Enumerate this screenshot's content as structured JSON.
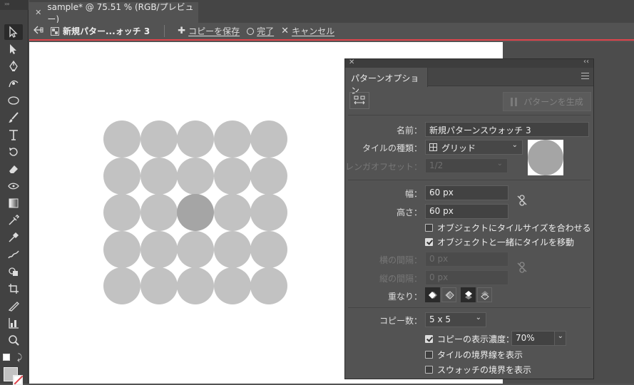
{
  "toolbar": {
    "grip": "›››",
    "tools": [
      "selection-tool",
      "direct-selection-tool",
      "pen-tool",
      "curvature-tool",
      "ellipse-tool",
      "paintbrush-tool",
      "type-tool",
      "rotate-tool",
      "eraser-tool",
      "width-tool",
      "gradient-tool",
      "eyedropper-tool",
      "blend-tool",
      "puppet-warp-tool",
      "shape-builder-tool",
      "artboard-tool",
      "perspective-tool",
      "column-graph-tool",
      "zoom-tool"
    ]
  },
  "document": {
    "tab_title": "sample* @ 75.51 % (RGB/プレビュー)"
  },
  "isolation_bar": {
    "name": "新規パター...ォッチ 3",
    "save_copy": "コピーを保存",
    "done": "完了",
    "cancel": "キャンセル"
  },
  "panel": {
    "tab": "パターンオプション",
    "generate_button": "パターンを生成",
    "name_label": "名前：",
    "name_value": "新規パターンスウォッチ 3",
    "tile_type_label": "タイルの種類：",
    "tile_type_value": "グリッド",
    "brick_offset_label": "レンガオフセット：",
    "brick_offset_value": "1/2",
    "width_label": "幅：",
    "width_value": "60 px",
    "height_label": "高さ：",
    "height_value": "60 px",
    "fit_tile_label": "オブジェクトにタイルサイズを合わせる",
    "fit_tile_checked": false,
    "move_tile_label": "オブジェクトと一緒にタイルを移動",
    "move_tile_checked": true,
    "h_spacing_label": "横の間隔：",
    "h_spacing_value": "0 px",
    "v_spacing_label": "縦の間隔：",
    "v_spacing_value": "0 px",
    "overlap_label": "重なり：",
    "copies_label": "コピー数：",
    "copies_value": "5 x 5",
    "dim_copies_label": "コピーの表示濃度：",
    "dim_copies_checked": true,
    "dim_copies_value": "70%",
    "show_tile_edge_label": "タイルの境界線を表示",
    "show_tile_edge_checked": false,
    "show_swatch_bounds_label": "スウォッチの境界を表示",
    "show_swatch_bounds_checked": false
  },
  "colors": {
    "accent_line": "#e0434b",
    "circle": "#c2c2c2",
    "circle_original": "#a5a5a5",
    "panel_bg": "#535353"
  }
}
